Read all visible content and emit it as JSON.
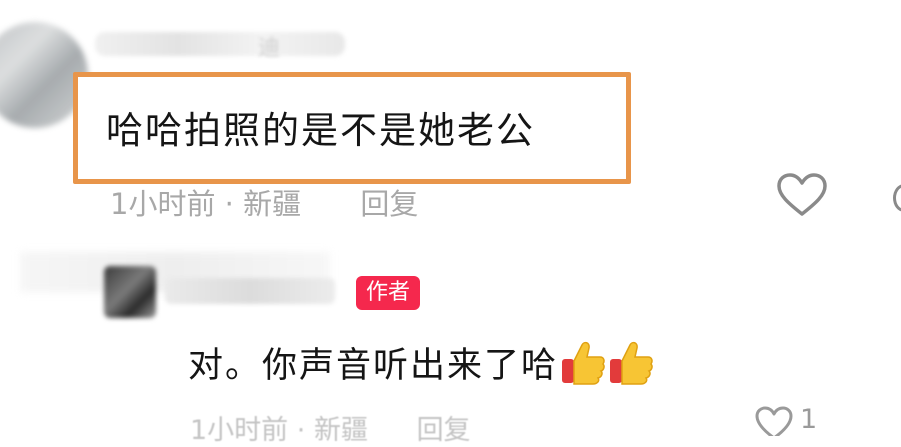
{
  "comment_1": {
    "name_fragment": "迪",
    "text": "哈哈拍照的是不是她老公",
    "time": "1小时前",
    "location": "新疆",
    "reply_label": "回复",
    "separator": "·"
  },
  "reply": {
    "author_badge": "作者",
    "text": "对。你声音听出来了哈",
    "emoji": [
      "thumbs-up-icon",
      "thumbs-up-icon"
    ],
    "time": "1小时前",
    "location": "新疆",
    "reply_label": "回复",
    "like_count": "1"
  },
  "colors": {
    "highlight": "#e8954a",
    "badge": "#f5284d",
    "meta_text": "#a8a8a8"
  }
}
